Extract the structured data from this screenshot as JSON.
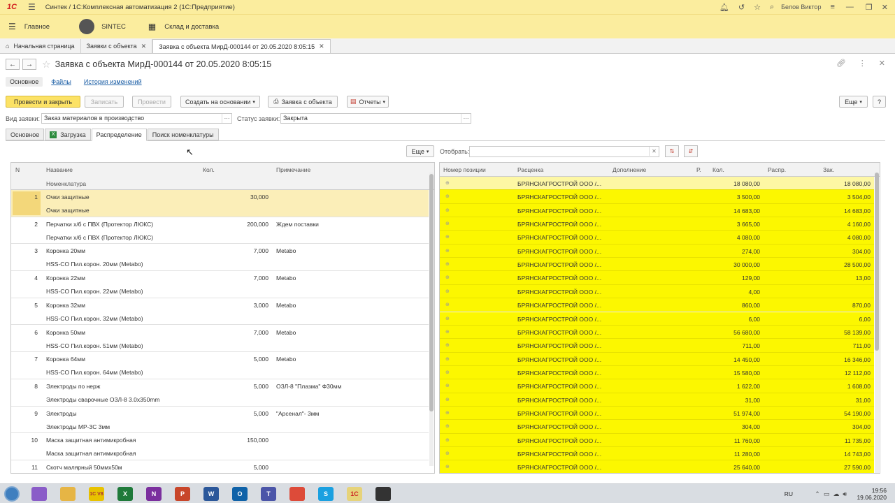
{
  "titlebar": {
    "title": "Синтек / 1С:Комплексная автоматизация 2  (1С:Предприятие)",
    "user": "Белов Виктор",
    "logo_text": "1С"
  },
  "sections": [
    {
      "label": "Главное",
      "icon": "hamburger-icon"
    },
    {
      "label": "SINTEC",
      "icon": "avatar"
    },
    {
      "label": "Склад и доставка",
      "icon": "grid-icon"
    }
  ],
  "open_tabs": [
    {
      "label": "Начальная страница"
    },
    {
      "label": "Заявки с объекта"
    },
    {
      "label": "Заявка с объекта МирД-000144 от 20.05.2020 8:05:15"
    }
  ],
  "form": {
    "title": "Заявка с объекта МирД-000144 от 20.05.2020 8:05:15",
    "nav": {
      "main": "Основное",
      "files": "Файлы",
      "history": "История изменений"
    },
    "commands": {
      "post_close": "Провести и закрыть",
      "save": "Записать",
      "post": "Провести",
      "create_based": "Создать на основании",
      "request_print": "Заявка с объекта",
      "reports": "Отчеты",
      "more": "Еще",
      "help": "?"
    },
    "fields": {
      "kind_label": "Вид заявки:",
      "kind_value": "Заказ материалов в производство",
      "status_label": "Статус заявки:",
      "status_value": "Закрыта"
    },
    "tabs": [
      "Основное",
      "Загрузка",
      "Распределение",
      "Поиск номенклатуры"
    ],
    "active_tab": "Распределение"
  },
  "left_table": {
    "more": "Еще",
    "headers": {
      "n": "N",
      "name": "Название",
      "nomen": "Номенклатура",
      "qty": "Кол.",
      "note": "Примечание"
    },
    "rows": [
      {
        "n": "1",
        "name": "Очки защитные",
        "nomen": "Очки защитные",
        "qty": "30,000",
        "note": ""
      },
      {
        "n": "2",
        "name": "Перчатки х/б с ПВХ (Протектор ЛЮКС)",
        "nomen": "Перчатки х/б с ПВХ (Протектор ЛЮКС)",
        "qty": "200,000",
        "note": "Ждем поставки"
      },
      {
        "n": "3",
        "name": "Коронка 20мм",
        "nomen": "HSS-CO Пил.корон. 20мм (Metabo)",
        "qty": "7,000",
        "note": "Metabo"
      },
      {
        "n": "4",
        "name": "Коронка 22мм",
        "nomen": "HSS-CO Пил.корон. 22мм (Metabo)",
        "qty": "7,000",
        "note": "Metabo"
      },
      {
        "n": "5",
        "name": "Коронка 32мм",
        "nomen": "HSS-CO Пил.корон. 32мм (Metabo)",
        "qty": "3,000",
        "note": "Metabo"
      },
      {
        "n": "6",
        "name": "Коронка 50мм",
        "nomen": "HSS-CO Пил.корон. 51мм (Metabo)",
        "qty": "7,000",
        "note": "Metabo"
      },
      {
        "n": "7",
        "name": "Коронка 64мм",
        "nomen": "HSS-CO Пил.корон. 64мм (Metabo)",
        "qty": "5,000",
        "note": "Metabo"
      },
      {
        "n": "8",
        "name": "Электроды по нерж",
        "nomen": "Электроды сварочные ОЗЛ-8 3.0х350mm",
        "qty": "5,000",
        "note": "ОЗЛ-8 \"Плазма\" Ф30мм"
      },
      {
        "n": "9",
        "name": "Электроды",
        "nomen": "Электроды МР-3С 3мм",
        "qty": "5,000",
        "note": "\"Арсенал\"- 3мм"
      },
      {
        "n": "10",
        "name": "Маска защитная антимикробная",
        "nomen": "Маска защитная антимикробная",
        "qty": "150,000",
        "note": ""
      },
      {
        "n": "11",
        "name": "Скотч малярный 50ммх50м",
        "nomen": "",
        "qty": "5,000",
        "note": ""
      }
    ]
  },
  "right_table": {
    "filter_label": "Отобрать:",
    "filter_value": "",
    "headers": {
      "pos": "Номер позиции",
      "price": "Расценка",
      "extra": "Дополнение",
      "r": "Р.",
      "kol": "Кол.",
      "distr": "Распр.",
      "zak": "Зак."
    },
    "org": "БРЯНСКАГРОСТРОЙ ООО /...",
    "rows": [
      {
        "kol": "18 080,00",
        "zak": "18 080,00"
      },
      {
        "kol": "3 500,00",
        "zak": "3 504,00"
      },
      {
        "kol": "14 683,00",
        "zak": "14 683,00"
      },
      {
        "kol": "3 665,00",
        "zak": "4 160,00"
      },
      {
        "kol": "4 080,00",
        "zak": "4 080,00"
      },
      {
        "kol": "274,00",
        "zak": "304,00"
      },
      {
        "kol": "30 000,00",
        "zak": "28 500,00"
      },
      {
        "kol": "129,00",
        "zak": "13,00"
      },
      {
        "kol": "4,00",
        "zak": ""
      },
      {
        "kol": "860,00",
        "zak": "870,00"
      },
      {
        "kol": "6,00",
        "zak": "6,00"
      },
      {
        "kol": "56 680,00",
        "zak": "58 139,00"
      },
      {
        "kol": "711,00",
        "zak": "711,00"
      },
      {
        "kol": "14 450,00",
        "zak": "16 346,00"
      },
      {
        "kol": "15 580,00",
        "zak": "12 112,00"
      },
      {
        "kol": "1 622,00",
        "zak": "1 608,00"
      },
      {
        "kol": "31,00",
        "zak": "31,00"
      },
      {
        "kol": "51 974,00",
        "zak": "54 190,00"
      },
      {
        "kol": "304,00",
        "zak": "304,00"
      },
      {
        "kol": "11 760,00",
        "zak": "11 735,00"
      },
      {
        "kol": "11 280,00",
        "zak": "14 743,00"
      },
      {
        "kol": "25 640,00",
        "zak": "27 590,00"
      }
    ]
  },
  "taskbar": {
    "lang": "RU",
    "time": "19:56",
    "date": "19.06.2020",
    "apps": [
      {
        "label": "",
        "color": "#8a5cc8",
        "icon": "chat-icon"
      },
      {
        "label": "",
        "color": "#e6b545",
        "icon": "folder-icon"
      },
      {
        "label": "1С V8",
        "color": "#e8c200",
        "icon": "1c-v8-icon"
      },
      {
        "label": "X",
        "color": "#1f7a3a",
        "icon": "excel-icon"
      },
      {
        "label": "N",
        "color": "#7b2f9e",
        "icon": "onenote-icon"
      },
      {
        "label": "P",
        "color": "#c8462a",
        "icon": "powerpoint-icon"
      },
      {
        "label": "W",
        "color": "#2b579a",
        "icon": "word-icon"
      },
      {
        "label": "O",
        "color": "#0f62a8",
        "icon": "outlook-icon"
      },
      {
        "label": "T",
        "color": "#4b55a8",
        "icon": "teams-icon"
      },
      {
        "label": "",
        "color": "#dd4b39",
        "icon": "chrome-icon"
      },
      {
        "label": "S",
        "color": "#1aa0e0",
        "icon": "skype-icon"
      },
      {
        "label": "1С",
        "color": "#e6d37a",
        "icon": "1c-icon"
      },
      {
        "label": "",
        "color": "#333333",
        "icon": "media-icon"
      }
    ]
  }
}
